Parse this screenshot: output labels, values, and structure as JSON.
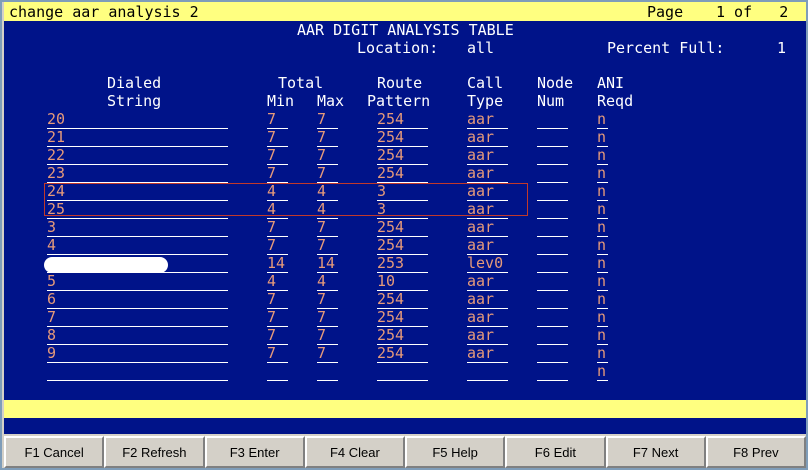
{
  "title": {
    "command": "change aar analysis 2",
    "page_label": "Page",
    "page_of": "1 of   2"
  },
  "header": {
    "table_title": "AAR DIGIT ANALYSIS TABLE",
    "location_label": "Location:",
    "location_value": "all",
    "percent_full_label": "Percent Full:",
    "percent_full_value": "1"
  },
  "columns": {
    "dialed_line1": "Dialed",
    "dialed_line2": "String",
    "total_line1": "Total",
    "min": "Min",
    "max": "Max",
    "route_line1": "Route",
    "route_line2": "Pattern",
    "call_line1": "Call",
    "call_line2": "Type",
    "node_line1": "Node",
    "node_line2": "Num",
    "ani_line1": "ANI",
    "ani_line2": "Reqd"
  },
  "rows": [
    {
      "dialed": "20",
      "min": "7",
      "max": "7",
      "route": "254",
      "type": "aar",
      "node": "",
      "ani": "n"
    },
    {
      "dialed": "21",
      "min": "7",
      "max": "7",
      "route": "254",
      "type": "aar",
      "node": "",
      "ani": "n"
    },
    {
      "dialed": "22",
      "min": "7",
      "max": "7",
      "route": "254",
      "type": "aar",
      "node": "",
      "ani": "n"
    },
    {
      "dialed": "23",
      "min": "7",
      "max": "7",
      "route": "254",
      "type": "aar",
      "node": "",
      "ani": "n"
    },
    {
      "dialed": "24",
      "min": "4",
      "max": "4",
      "route": "3",
      "type": "aar",
      "node": "",
      "ani": "n"
    },
    {
      "dialed": "25",
      "min": "4",
      "max": "4",
      "route": "3",
      "type": "aar",
      "node": "",
      "ani": "n"
    },
    {
      "dialed": "3",
      "min": "7",
      "max": "7",
      "route": "254",
      "type": "aar",
      "node": "",
      "ani": "n"
    },
    {
      "dialed": "4",
      "min": "7",
      "max": "7",
      "route": "254",
      "type": "aar",
      "node": "",
      "ani": "n"
    },
    {
      "dialed": "",
      "min": "14",
      "max": "14",
      "route": "253",
      "type": "lev0",
      "node": "",
      "ani": "n"
    },
    {
      "dialed": "5",
      "min": "4",
      "max": "4",
      "route": "10",
      "type": "aar",
      "node": "",
      "ani": "n"
    },
    {
      "dialed": "6",
      "min": "7",
      "max": "7",
      "route": "254",
      "type": "aar",
      "node": "",
      "ani": "n"
    },
    {
      "dialed": "7",
      "min": "7",
      "max": "7",
      "route": "254",
      "type": "aar",
      "node": "",
      "ani": "n"
    },
    {
      "dialed": "8",
      "min": "7",
      "max": "7",
      "route": "254",
      "type": "aar",
      "node": "",
      "ani": "n"
    },
    {
      "dialed": "9",
      "min": "7",
      "max": "7",
      "route": "254",
      "type": "aar",
      "node": "",
      "ani": "n"
    },
    {
      "dialed": "",
      "min": "",
      "max": "",
      "route": "",
      "type": "",
      "node": "",
      "ani": "n"
    }
  ],
  "function_keys": [
    {
      "label": "F1 Cancel"
    },
    {
      "label": "F2 Refresh"
    },
    {
      "label": "F3 Enter"
    },
    {
      "label": "F4 Clear"
    },
    {
      "label": "F5 Help"
    },
    {
      "label": "F6 Edit"
    },
    {
      "label": "F7 Next"
    },
    {
      "label": "F8 Prev"
    }
  ],
  "colors": {
    "screen_background": "#001389",
    "field_text": "#e59a7a",
    "title_bar": "#ffff80",
    "highlight_box": "#c0392b"
  }
}
